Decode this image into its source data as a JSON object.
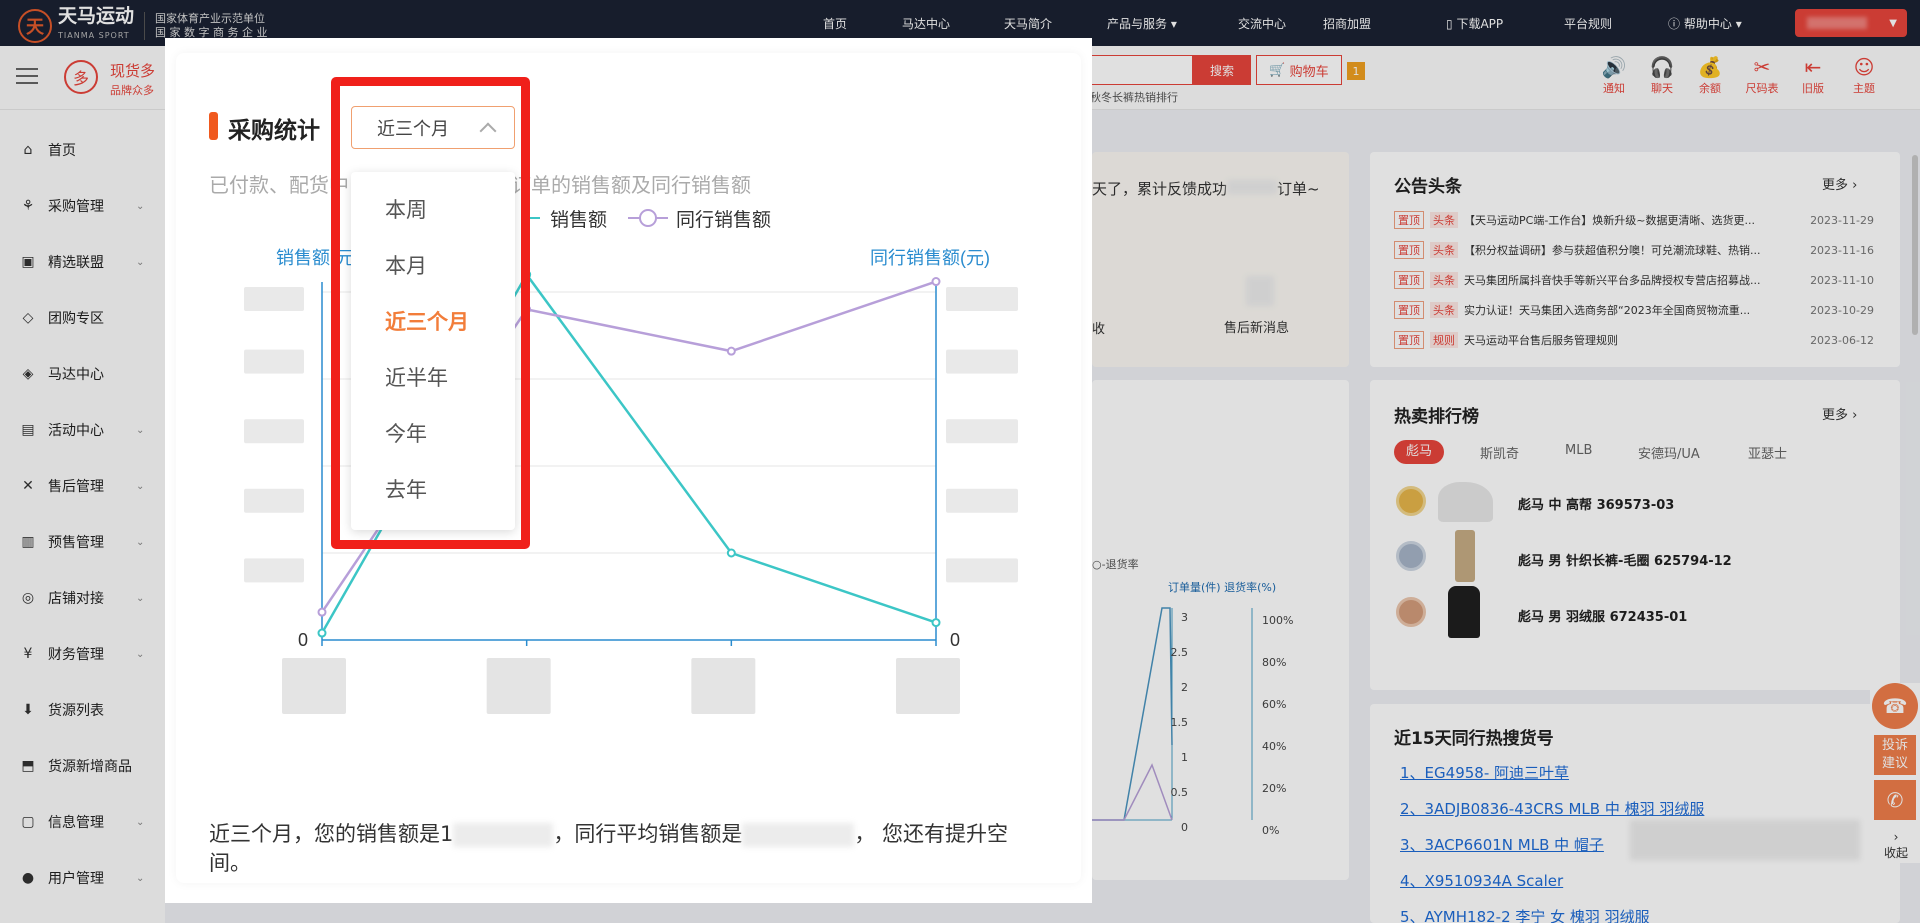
{
  "topnav": {
    "brand": "天马运动",
    "brand_en": "TIANMA SPORT",
    "tag_line1": "国家体育产业示范单位",
    "tag_line2": "国 家 数 字 商 务 企 业",
    "links": [
      "首页",
      "马达中心",
      "天马简介",
      "产品与服务",
      "交流中心",
      "招商加盟",
      "下载APP",
      "平台规则",
      "帮助中心"
    ]
  },
  "subheader": {
    "duo_char": "多",
    "title": "现货多",
    "subtitle": "品牌众多",
    "search_label": "搜索",
    "cart_label": "购物车",
    "cart_count": "1",
    "hot_hint": "秋冬长裤热销排行",
    "icons": [
      {
        "name": "notice-icon",
        "label": "通知",
        "glyph": "🔊"
      },
      {
        "name": "chat-icon",
        "label": "聊天",
        "glyph": "🎧"
      },
      {
        "name": "balance-icon",
        "label": "余额",
        "glyph": "💰"
      },
      {
        "name": "size-chart-icon",
        "label": "尺码表",
        "glyph": "✂"
      },
      {
        "name": "old-version-icon",
        "label": "旧版",
        "glyph": "⇤"
      },
      {
        "name": "theme-icon",
        "label": "主题",
        "glyph": "☺"
      }
    ]
  },
  "sidebar": {
    "items": [
      {
        "label": "首页",
        "icon": "home-icon",
        "glyph": "⌂",
        "sub": false
      },
      {
        "label": "采购管理",
        "icon": "purchase-icon",
        "glyph": "⚘",
        "sub": true
      },
      {
        "label": "精选联盟",
        "icon": "alliance-icon",
        "glyph": "▣",
        "sub": true
      },
      {
        "label": "团购专区",
        "icon": "group-buy-icon",
        "glyph": "◇",
        "sub": false
      },
      {
        "label": "马达中心",
        "icon": "mada-icon",
        "glyph": "◈",
        "sub": false
      },
      {
        "label": "活动中心",
        "icon": "activity-icon",
        "glyph": "▤",
        "sub": true
      },
      {
        "label": "售后管理",
        "icon": "aftersale-icon",
        "glyph": "✕",
        "sub": true
      },
      {
        "label": "预售管理",
        "icon": "presale-icon",
        "glyph": "▥",
        "sub": true
      },
      {
        "label": "店铺对接",
        "icon": "store-icon",
        "glyph": "◎",
        "sub": true
      },
      {
        "label": "财务管理",
        "icon": "finance-icon",
        "glyph": "¥",
        "sub": true
      },
      {
        "label": "货源列表",
        "icon": "source-list-icon",
        "glyph": "⬇",
        "sub": false
      },
      {
        "label": "货源新增商品",
        "icon": "new-goods-icon",
        "glyph": "⬒",
        "sub": false
      },
      {
        "label": "信息管理",
        "icon": "info-icon",
        "glyph": "▢",
        "sub": true
      },
      {
        "label": "用户管理",
        "icon": "user-icon",
        "glyph": "●",
        "sub": true
      }
    ]
  },
  "background": {
    "announce_text": "天了，累计反馈成功",
    "announce_suffix": "订单~",
    "stat_label_left": "收",
    "stat_label_right": "售后新消息",
    "notices_title": "公告头条",
    "more": "更多",
    "notices": [
      {
        "tag1": "置顶",
        "tag2": "头条",
        "text": "【天马运动PC端-工作台】焕新升级~数据更清晰、选货更...",
        "date": "2023-11-29"
      },
      {
        "tag1": "置顶",
        "tag2": "头条",
        "text": "【积分权益调研】参与获超值积分噢！可兑潮流球鞋、热销...",
        "date": "2023-11-16"
      },
      {
        "tag1": "置顶",
        "tag2": "头条",
        "text": "天马集团所属抖音快手等新兴平台多品牌授权专营店招募战...",
        "date": "2023-11-10"
      },
      {
        "tag1": "置顶",
        "tag2": "头条",
        "text": "实力认证！天马集团入选商务部“2023年全国商贸物流重...",
        "date": "2023-10-29"
      },
      {
        "tag1": "置顶",
        "tag2": "规则",
        "text": "天马运动平台售后服务管理规则",
        "date": "2023-06-12"
      }
    ],
    "hot_title": "热卖排行榜",
    "hot_tabs": [
      "彪马",
      "斯凯奇",
      "MLB",
      "安德玛/UA",
      "亚瑟士"
    ],
    "hot_items": [
      "彪马 中 高帮 369573-03",
      "彪马 男 针织长裤-毛圈 625794-12",
      "彪马 男 羽绒服 672435-01"
    ],
    "search_title": "近15天同行热搜货号",
    "search_items": [
      "1、EG4958- 阿迪三叶草",
      "2、3ADJB0836-43CRS MLB 中 槐羽 羽绒服",
      "3、3ACP6601N MLB 中 帽子",
      "4、X9510934A Scaler",
      "5、AYMH182-2 李宁 女 槐羽 羽绒服"
    ],
    "mini_chart_legend": "退货率",
    "mini_chart_axis1": "订单量(件)",
    "mini_chart_axis2": "退货率(%)",
    "mini_left_ticks": [
      "3",
      "2.5",
      "2",
      "1.5",
      "1",
      "0.5",
      "0"
    ],
    "mini_right_ticks": [
      "100%",
      "80%",
      "60%",
      "40%",
      "20%",
      "0%"
    ],
    "widget_label1": "投诉",
    "widget_label2": "建议",
    "widget_collapse": "收起"
  },
  "modal": {
    "title": "采购统计",
    "period_selected": "近三个月",
    "description": "已付款、配货中",
    "description_tail": "订单的销售额及同行销售额",
    "period_options": [
      "本周",
      "本月",
      "近三个月",
      "近半年",
      "今年",
      "去年"
    ],
    "summary_prefix": "近三个月，您的销售额是1",
    "summary_mid": "，同行平均销售额是",
    "summary_suffix": "，  您还有提升空间。"
  },
  "chart_data": {
    "type": "line",
    "legend": [
      "销售额",
      "同行销售额"
    ],
    "ylabel": "销售额(元)",
    "ylabel_right": "同行销售额(元)",
    "y_tick_visible": [
      "0"
    ],
    "y_right_tick_visible": [
      "0"
    ],
    "colors": {
      "sales": "#3cc6c6",
      "peer": "#b79fd9"
    },
    "series": [
      {
        "name": "销售额",
        "values": [
          0.02,
          1.05,
          0.25,
          0.05
        ]
      },
      {
        "name": "同行销售额",
        "values": [
          0.08,
          0.95,
          0.83,
          1.03
        ]
      }
    ]
  },
  "colors": {
    "accent": "#e8453c",
    "highlight": "#f0201a",
    "active_option": "#f27d3a"
  }
}
